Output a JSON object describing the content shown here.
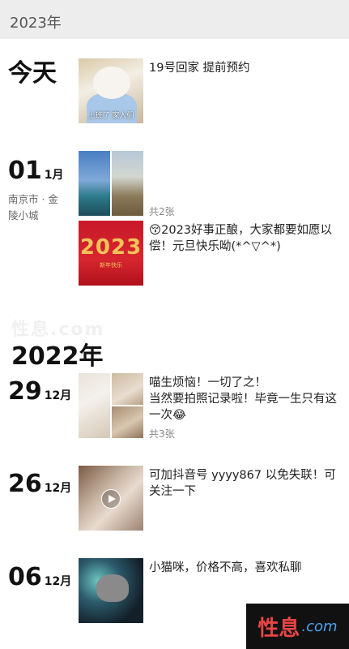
{
  "header": {
    "year_label": "2023年"
  },
  "watermark": {
    "cn": "性息",
    "com": ".com"
  },
  "entries": [
    {
      "date_label": "今天",
      "text": "19号回家  提前预约",
      "image_caption": "上班了 家人们"
    },
    {
      "day": "01",
      "month": "1月",
      "location": "南京市 · 金陵小城",
      "count": "共2张",
      "text2": "😚2023好事正酿，大家都要如愿以偿！元旦快乐呦(*^▽^*)",
      "img_2023": "2023",
      "img_2023_sub": "新年快乐"
    },
    {
      "year_label": "2022年",
      "day": "29",
      "month": "12月",
      "text": "喵生烦恼！一切了之！\n当然要拍照记录啦！毕竟一生只有这一次😂",
      "count": "共3张"
    },
    {
      "day": "26",
      "month": "12月",
      "text": "可加抖音号 yyyy867 以免失联！可关注一下"
    },
    {
      "day": "06",
      "month": "12月",
      "text": "小猫咪，价格不高，喜欢私聊"
    }
  ]
}
